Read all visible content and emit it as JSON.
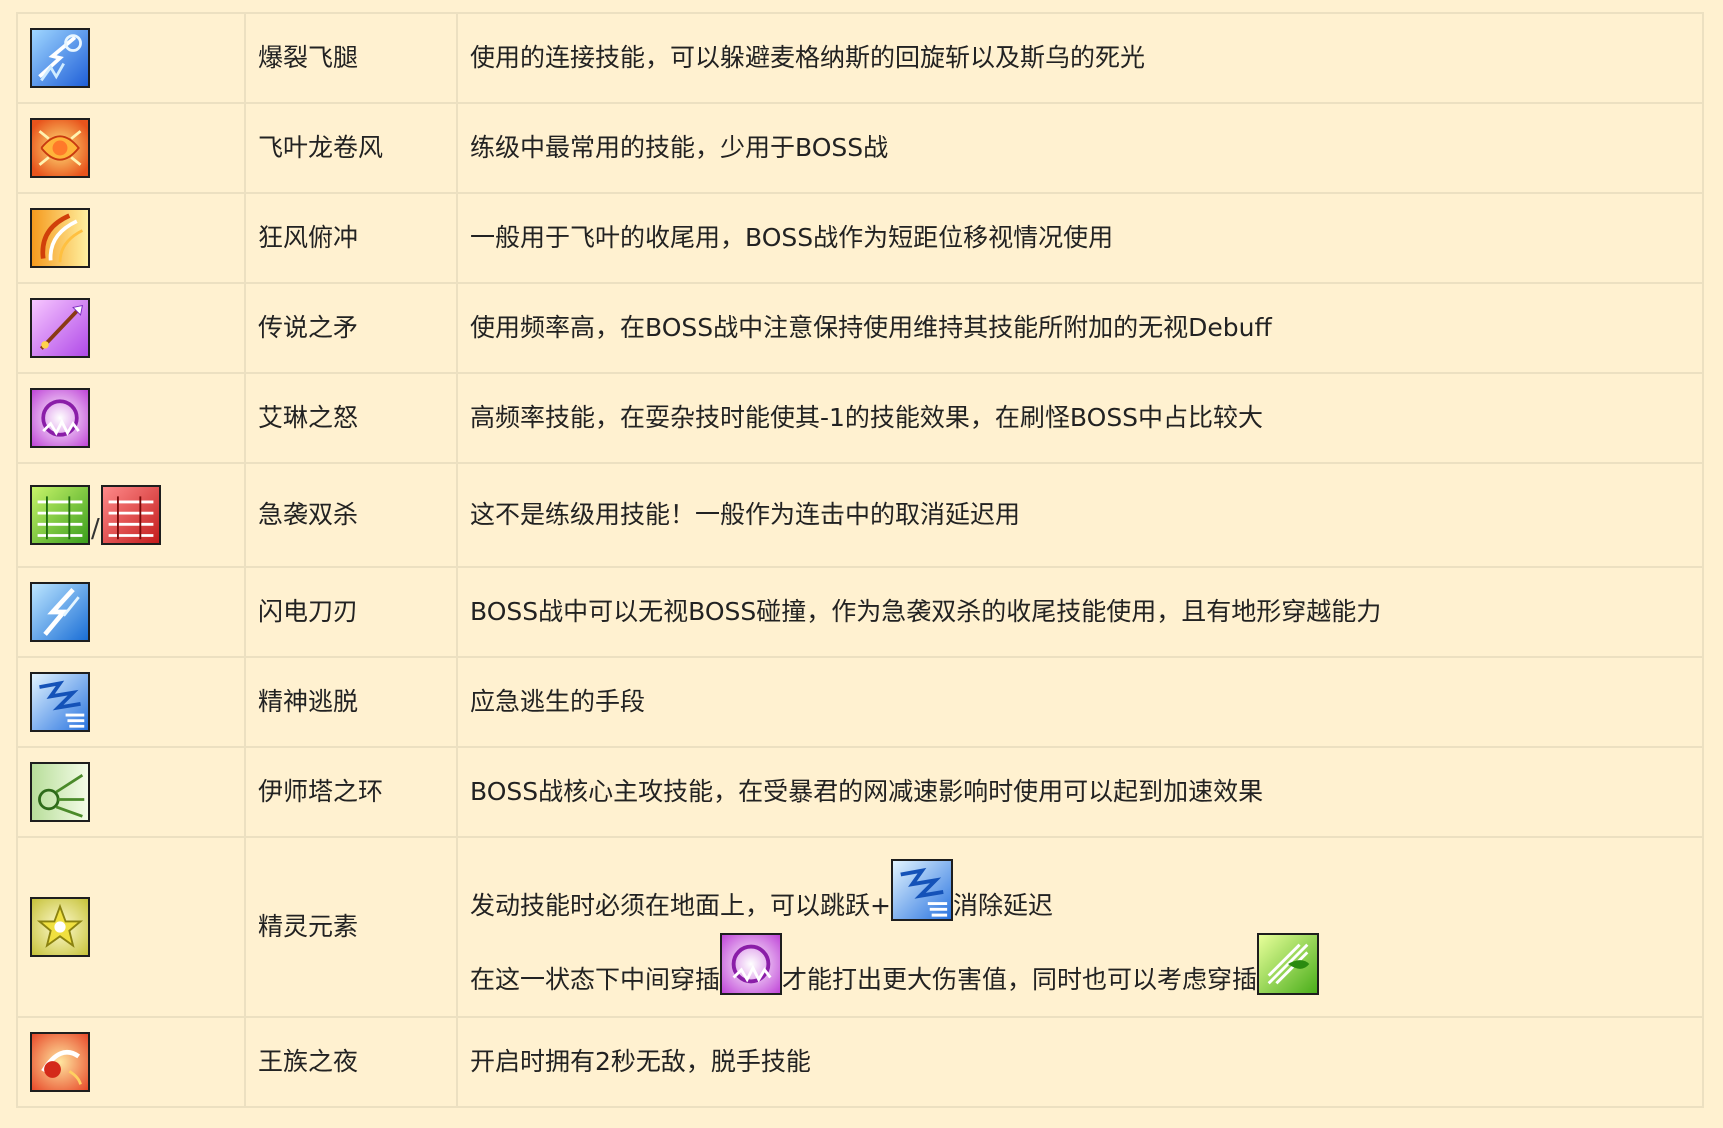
{
  "rows": [
    {
      "icon": "blast-kick-icon",
      "name": "爆裂飞腿",
      "desc": "使用的连接技能，可以躲避麦格纳斯的回旋斩以及斯乌的死光"
    },
    {
      "icon": "leaf-tornado-icon",
      "name": "飞叶龙卷风",
      "desc": "练级中最常用的技能，少用于BOSS战"
    },
    {
      "icon": "gale-dash-icon",
      "name": "狂风俯冲",
      "desc": "一般用于飞叶的收尾用，BOSS战作为短距位移视情况使用"
    },
    {
      "icon": "legend-spear-icon",
      "name": "传说之矛",
      "desc": "使用频率高，在BOSS战中注意保持使用维持其技能所附加的无视Debuff"
    },
    {
      "icon": "elyn-wrath-icon",
      "name": "艾琳之怒",
      "desc": "高频率技能，在耍杂技时能使其-1的技能效果，在刷怪BOSS中占比较大"
    },
    {
      "icon": "rush-double-green-icon",
      "icon2": "rush-double-red-icon",
      "separator": "/",
      "name": "急袭双杀",
      "desc": "这不是练级用技能！一般作为连击中的取消延迟用"
    },
    {
      "icon": "lightning-blade-icon",
      "name": "闪电刀刃",
      "desc": "BOSS战中可以无视BOSS碰撞，作为急袭双杀的收尾技能使用，且有地形穿越能力"
    },
    {
      "icon": "spirit-escape-icon",
      "name": "精神逃脱",
      "desc": "应急逃生的手段"
    },
    {
      "icon": "ishtar-ring-icon",
      "name": "伊师塔之环",
      "desc": "BOSS战核心主攻技能，在受暴君的网减速影响时使用可以起到加速效果"
    },
    {
      "icon": "spirit-element-icon",
      "name": "精灵元素",
      "desc_line1_a": "发动技能时必须在地面上，可以跳跃+",
      "desc_line1_icon": "spirit-escape-icon",
      "desc_line1_b": "消除延迟",
      "desc_line2_a": "在这一状态下中间穿插",
      "desc_line2_icon": "elyn-wrath-icon",
      "desc_line2_b": "才能打出更大伤害值，同时也可以考虑穿插",
      "desc_line2_icon2": "leaf-burst-icon"
    },
    {
      "icon": "royal-night-icon",
      "name": "王族之夜",
      "desc": "开启时拥有2秒无敌，脱手技能"
    }
  ]
}
